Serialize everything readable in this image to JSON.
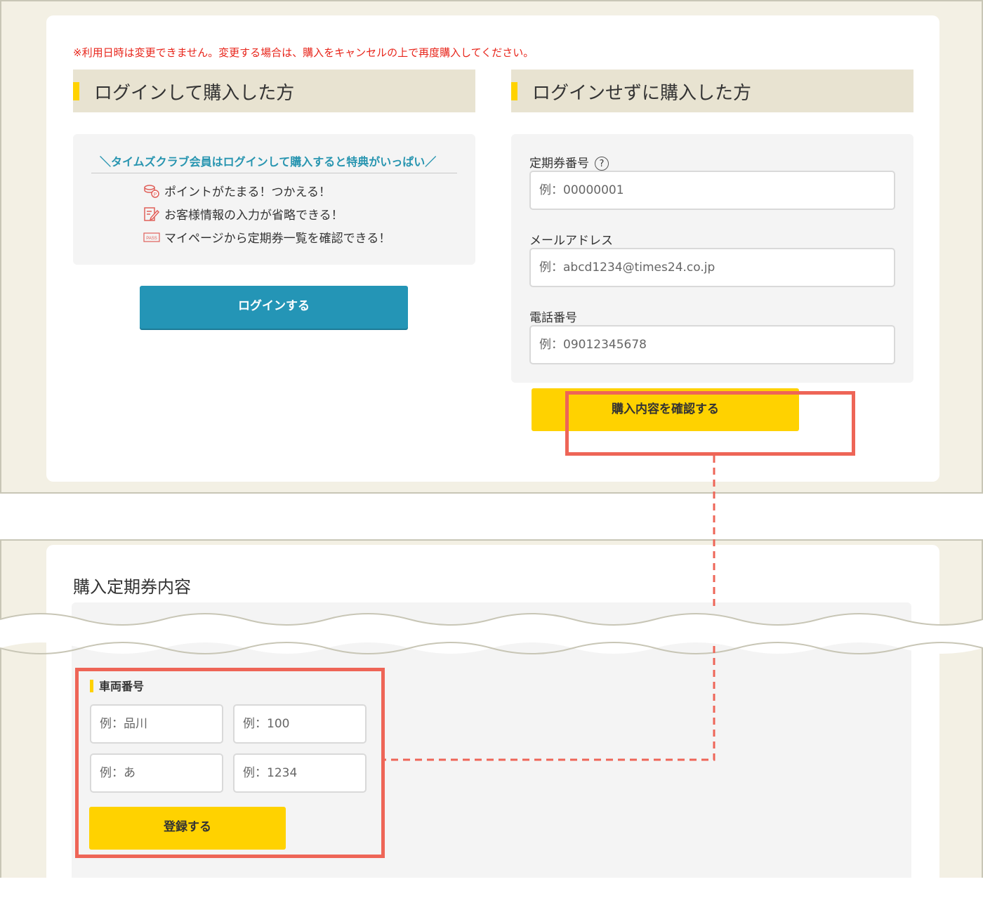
{
  "notice": "※利用日時は変更できません。変更する場合は、購入をキャンセルの上で再度購入してください。",
  "login_section": {
    "heading": "ログインして購入した方",
    "benefits_title": "＼タイムズクラブ会員はログインして購入すると特典がいっぱい／",
    "benefits": [
      {
        "icon": "coin-points-icon",
        "text": "ポイントがたまる！つかえる！"
      },
      {
        "icon": "edit-form-icon",
        "text": "お客様情報の入力が省略できる！"
      },
      {
        "icon": "pass-ticket-icon",
        "text": "マイページから定期券一覧を確認できる！"
      }
    ],
    "login_button": "ログインする"
  },
  "guest_section": {
    "heading": "ログインせずに購入した方",
    "fields": [
      {
        "label": "定期券番号",
        "placeholder": "例：00000001"
      },
      {
        "label": "メールアドレス",
        "placeholder": "例：abcd1234@times24.co.jp"
      },
      {
        "label": "電話番号",
        "placeholder": "例：09012345678"
      }
    ],
    "help_icon": "?",
    "confirm_button": "購入内容を確認する"
  },
  "contents_section": {
    "title": "購入定期券内容",
    "vehicle_label": "車両番号",
    "vehicle_inputs": [
      {
        "placeholder": "例：品川"
      },
      {
        "placeholder": "例：100"
      },
      {
        "placeholder": "例：あ"
      },
      {
        "placeholder": "例：1234"
      }
    ],
    "register_button": "登録する"
  },
  "colors": {
    "accent_yellow": "#ffd200",
    "login_blue": "#2495b6",
    "highlight_red": "#ee6557",
    "notice_red": "#e8251b",
    "panel_beige": "#f3f0e4"
  }
}
